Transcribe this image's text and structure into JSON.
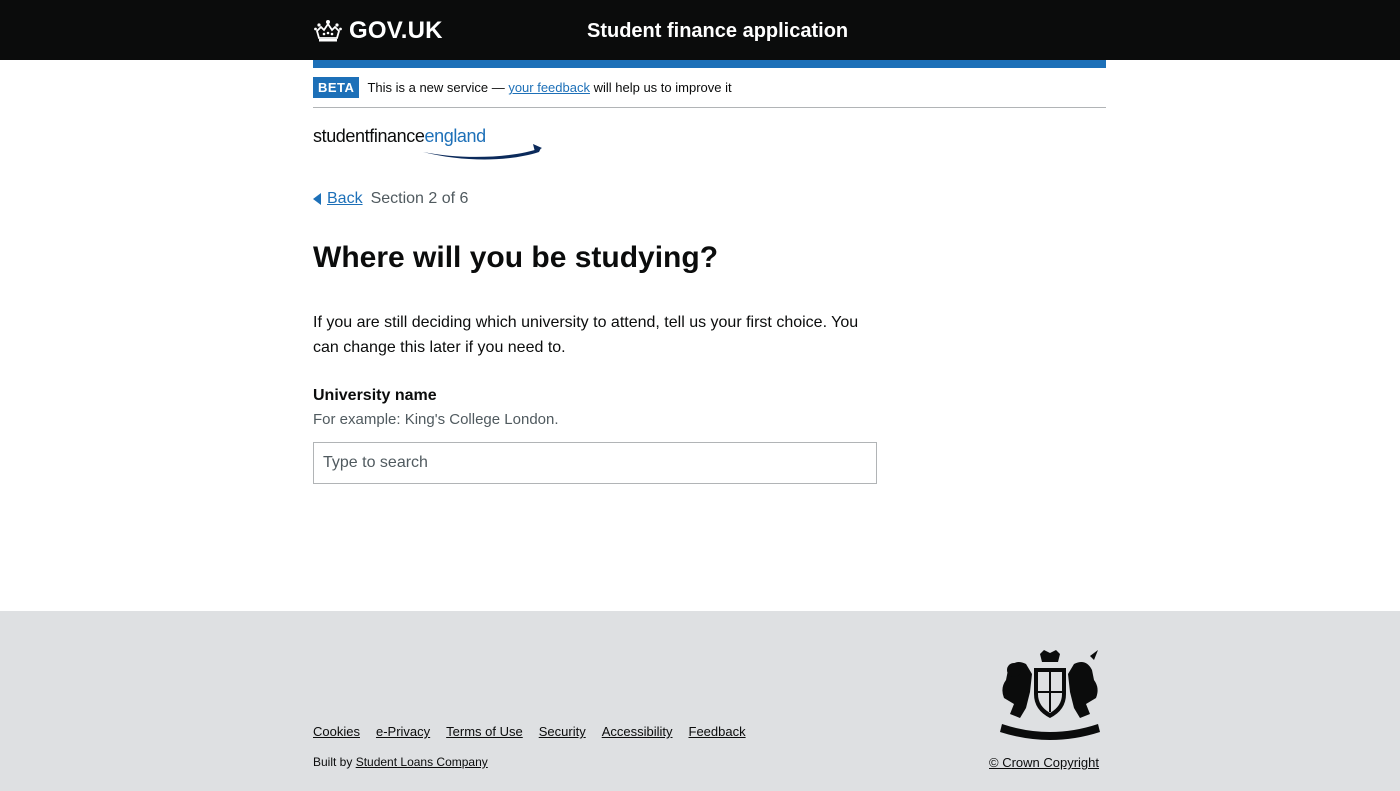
{
  "header": {
    "logo_text": "GOV.UK",
    "service_name": "Student finance application"
  },
  "phase_banner": {
    "tag": "BETA",
    "text_before": "This is a new service — ",
    "link": "your feedback",
    "text_after": " will help us to improve it"
  },
  "brand": {
    "part1": "studentfinance",
    "part2": "england"
  },
  "nav": {
    "back": "Back",
    "section": "Section 2 of 6"
  },
  "main": {
    "title": "Where will you be studying?",
    "lead": "If you are still deciding which university to attend, tell us your first choice. You can change this later if you need to.",
    "field_label": "University name",
    "field_hint": "For example: King's College London.",
    "search_placeholder": "Type to search",
    "search_value": ""
  },
  "footer": {
    "links": [
      "Cookies",
      "e-Privacy",
      "Terms of Use",
      "Security",
      "Accessibility",
      "Feedback"
    ],
    "built_by_prefix": "Built by ",
    "built_by_link": "Student Loans Company",
    "copyright": "© Crown Copyright"
  },
  "colors": {
    "header_bg": "#0b0c0c",
    "brand_blue": "#1d70b8",
    "footer_bg": "#dee0e2",
    "secondary_text": "#505a5f"
  },
  "icons": [
    "crown-icon",
    "back-arrow-icon",
    "royal-coat-of-arms-icon",
    "sfe-swoosh-icon"
  ]
}
